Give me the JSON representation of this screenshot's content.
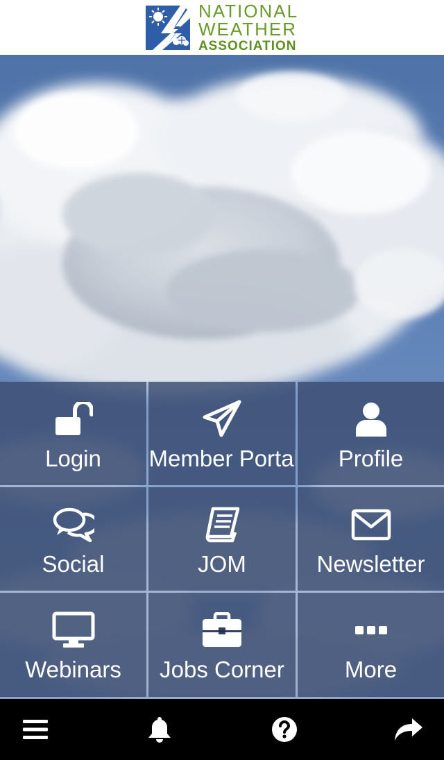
{
  "header": {
    "logo": {
      "line1": "NATIONAL",
      "line2": "WEATHER",
      "line3": "ASSOCIATION",
      "colors": {
        "blue": "#2f5ea8",
        "green": "#6a9a2c"
      }
    }
  },
  "grid": {
    "tiles": [
      {
        "label": "Login",
        "icon": "unlock-icon"
      },
      {
        "label": "Member Portal",
        "icon": "paper-plane-icon"
      },
      {
        "label": "Profile",
        "icon": "user-icon"
      },
      {
        "label": "Social",
        "icon": "chat-bubbles-icon"
      },
      {
        "label": "JOM",
        "icon": "book-icon"
      },
      {
        "label": "Newsletter",
        "icon": "envelope-icon"
      },
      {
        "label": "Webinars",
        "icon": "monitor-icon"
      },
      {
        "label": "Jobs Corner",
        "icon": "briefcase-icon"
      },
      {
        "label": "More",
        "icon": "ellipsis-icon"
      }
    ]
  },
  "bottombar": {
    "items": [
      {
        "icon": "menu-icon"
      },
      {
        "icon": "bell-icon"
      },
      {
        "icon": "help-icon"
      },
      {
        "icon": "share-icon"
      }
    ]
  }
}
